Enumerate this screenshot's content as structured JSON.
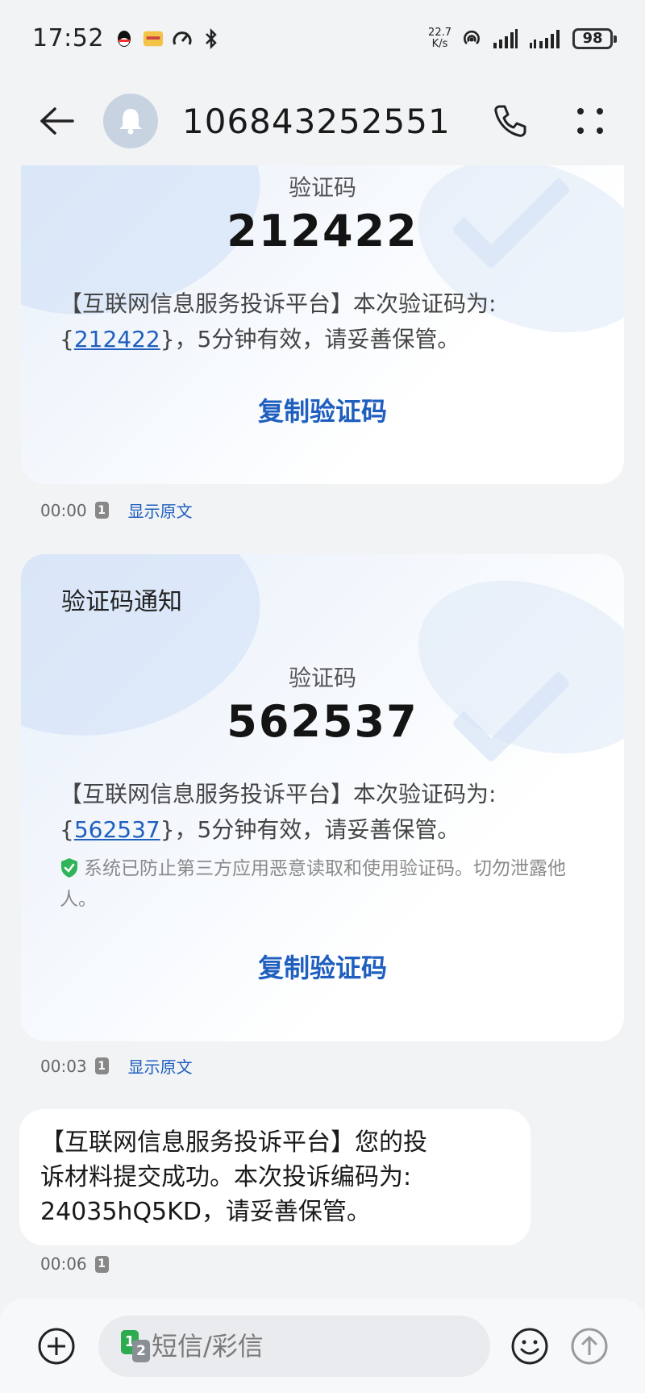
{
  "status_bar": {
    "time": "17:52",
    "net_speed_value": "22.7",
    "net_speed_unit": "K/s",
    "battery": "98",
    "icons": [
      "qq-icon",
      "app-notify-icon",
      "speed-icon",
      "bluetooth-icon",
      "hotspot-icon",
      "signal-icon",
      "signal-icon"
    ]
  },
  "header": {
    "title": "106843252551..."
  },
  "messages": [
    {
      "type": "code_card",
      "heading": "",
      "code_label": "验证码",
      "code": "212422",
      "body_prefix": "【互联网信息服务投诉平台】本次验证码为:",
      "body_open": "{",
      "body_code": "212422",
      "body_suffix": "}，5分钟有效，请妥善保管。",
      "copy_label": "复制验证码",
      "time": "00:00",
      "sim": "1",
      "show_original": "显示原文"
    },
    {
      "type": "code_card",
      "heading": "验证码通知",
      "code_label": "验证码",
      "code": "562537",
      "body_prefix": "【互联网信息服务投诉平台】本次验证码为:",
      "body_open": "{",
      "body_code": "562537",
      "body_suffix": "}，5分钟有效，请妥善保管。",
      "security_note": "系统已防止第三方应用恶意读取和使用验证码。切勿泄露他人。",
      "copy_label": "复制验证码",
      "time": "00:03",
      "sim": "1",
      "show_original": "显示原文"
    },
    {
      "type": "text",
      "lines": [
        "【互联网信息服务投诉平台】您的投",
        "诉材料提交成功。本次投诉编码为:",
        "24035hQ5KD，请妥善保管。"
      ],
      "time": "00:06",
      "sim": "1"
    }
  ],
  "composer": {
    "sim1": "1",
    "sim2": "2",
    "placeholder": "短信/彩信"
  },
  "colors": {
    "accent": "#1f5fbf",
    "background": "#f1f3f5",
    "sim_green": "#2eab4f",
    "shield_green": "#2fb45a"
  }
}
